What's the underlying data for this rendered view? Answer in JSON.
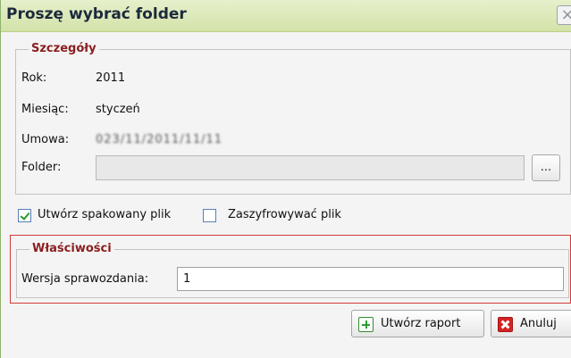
{
  "dialog": {
    "title": "Proszę wybrać folder",
    "close_symbol": "×"
  },
  "details": {
    "legend": "Szczegóły",
    "year_label": "Rok:",
    "year_value": "2011",
    "month_label": "Miesiąc:",
    "month_value": "styczeń",
    "contract_label": "Umowa:",
    "contract_value": "023/11/2011/11/11",
    "folder_label": "Folder:",
    "folder_value": "",
    "browse_label": "..."
  },
  "options": {
    "create_packed": {
      "label": "Utwórz spakowany plik",
      "checked": true
    },
    "encrypt": {
      "label": "Zaszyfrowywać plik",
      "checked": false
    }
  },
  "properties": {
    "legend": "Właściwości",
    "version_label": "Wersja sprawozdania:",
    "version_value": "1"
  },
  "buttons": {
    "create_report": {
      "label": "Utwórz raport",
      "icon": "plus-icon"
    },
    "cancel": {
      "label": "Anuluj",
      "icon": "cancel-x-icon"
    }
  },
  "colors": {
    "titlebar": "#d8e6b2",
    "legend_text": "#8b1e1e",
    "highlight_border": "#d23a3a"
  }
}
